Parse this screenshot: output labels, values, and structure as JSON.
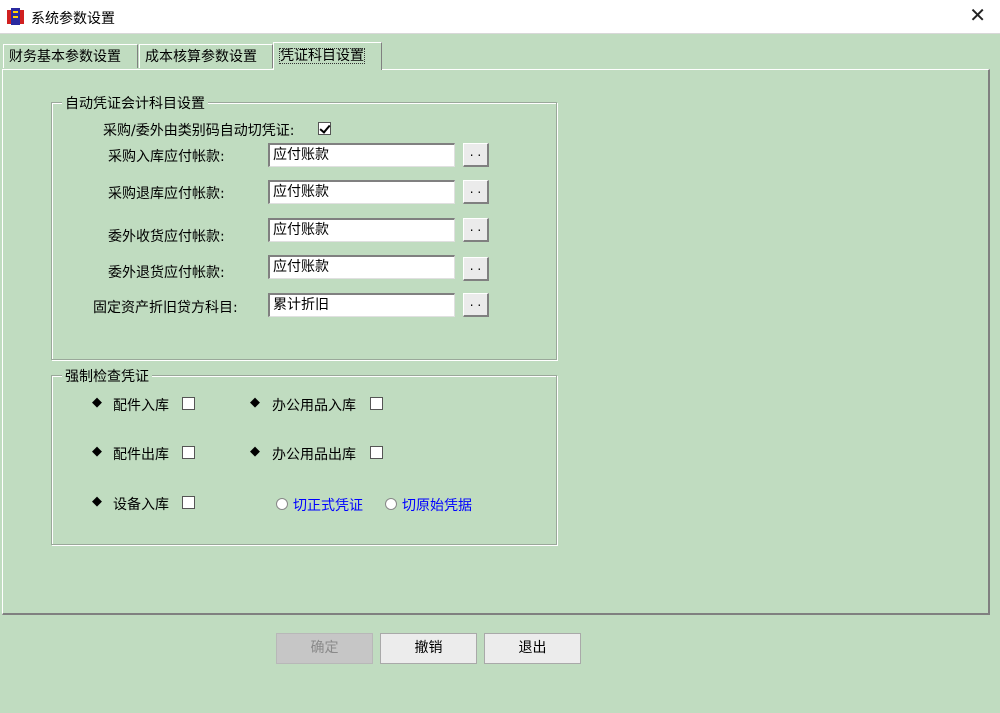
{
  "window": {
    "title": "系统参数设置",
    "close_glyph": "✕"
  },
  "tabs": [
    {
      "label": "财务基本参数设置"
    },
    {
      "label": "成本核算参数设置"
    },
    {
      "label": "凭证科目设置",
      "active": true
    }
  ],
  "auto_group": {
    "title": "自动凭证会计科目设置",
    "auto_cut": {
      "label": "采购/委外由类别码自动切凭证:",
      "checked": true
    },
    "fields": [
      {
        "label": "采购入库应付帐款:",
        "value": "应付账款",
        "button": ". ."
      },
      {
        "label": "采购退库应付帐款:",
        "value": "应付账款",
        "button": ". ."
      },
      {
        "label": "委外收货应付帐款:",
        "value": "应付账款",
        "button": ". ."
      },
      {
        "label": "委外退货应付帐款:",
        "value": "应付账款",
        "button": ". ."
      },
      {
        "label": "固定资产折旧贷方科目:",
        "value": "累计折旧",
        "button": ". ."
      }
    ]
  },
  "check_group": {
    "title": "强制检查凭证",
    "bullet": "◆",
    "items": [
      {
        "label": "配件入库",
        "checked": false
      },
      {
        "label": "办公用品入库",
        "checked": false
      },
      {
        "label": "配件出库",
        "checked": false
      },
      {
        "label": "办公用品出库",
        "checked": false
      },
      {
        "label": "设备入库",
        "checked": false
      }
    ],
    "radios": [
      {
        "label": "切正式凭证",
        "selected": false
      },
      {
        "label": "切原始凭据",
        "selected": false
      }
    ]
  },
  "buttons": {
    "ok": "确定",
    "cancel": "撤销",
    "exit": "退出"
  },
  "colors": {
    "background": "#c0dcc0",
    "radio_label": "#0000ff"
  }
}
